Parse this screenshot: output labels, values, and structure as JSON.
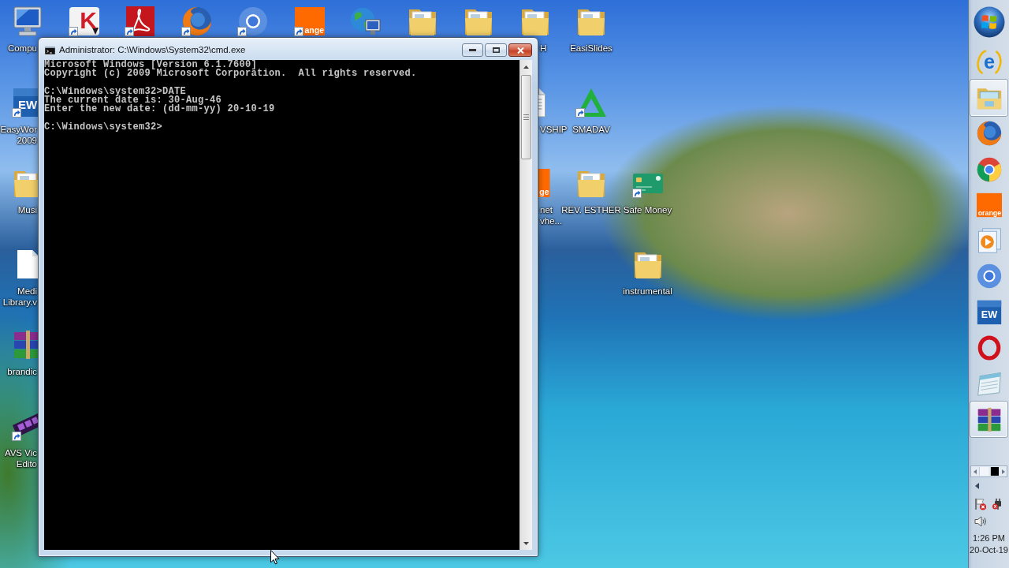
{
  "desktop": {
    "icons": [
      {
        "kind": "monitor",
        "label_lines": [
          "Compu"
        ],
        "shortcut": false
      },
      {
        "kind": "letter-logo",
        "logo_text": "K",
        "shortcut": true
      },
      {
        "kind": "swirl-tile",
        "shortcut": true
      },
      {
        "kind": "flame-globe",
        "shortcut": true
      },
      {
        "kind": "ring",
        "shortcut": true
      },
      {
        "kind": "orange-tile",
        "logo_text": "ange",
        "shortcut": true
      },
      {
        "kind": "globe-screen",
        "shortcut": false
      },
      {
        "kind": "folder",
        "shortcut": false
      },
      {
        "kind": "folder",
        "shortcut": false
      },
      {
        "kind": "folder",
        "label_lines": [
          "H"
        ],
        "shortcut": false
      },
      {
        "kind": "folder",
        "label_lines": [
          "EasiSlides"
        ],
        "shortcut": false
      },
      {
        "kind": "blue-tile",
        "logo_text": "EW",
        "label_lines": [
          "EasyWor",
          "2009"
        ],
        "shortcut": true
      },
      {
        "kind": "document",
        "label_lines": [
          "VSHIP"
        ],
        "shortcut": false
      },
      {
        "kind": "triangle",
        "label_lines": [
          "SMADAV"
        ],
        "shortcut": true
      },
      {
        "kind": "folder",
        "label_lines": [
          "Musi"
        ],
        "shortcut": false
      },
      {
        "kind": "orange-tile",
        "logo_text": "ge",
        "label_lines": [
          "net",
          "vhe..."
        ],
        "shortcut": false
      },
      {
        "kind": "folder",
        "label_lines": [
          "REV. ESTHER"
        ],
        "shortcut": false
      },
      {
        "kind": "card",
        "label_lines": [
          "Safe Money"
        ],
        "shortcut": true
      },
      {
        "kind": "blank-page",
        "label_lines": [
          "Medi",
          "Library.v"
        ],
        "shortcut": false
      },
      {
        "kind": "folder",
        "label_lines": [
          "instrumental"
        ],
        "shortcut": false
      },
      {
        "kind": "books",
        "label_lines": [
          "brandic"
        ],
        "shortcut": false
      },
      {
        "kind": "film",
        "label_lines": [
          "AVS Vic",
          "Edito"
        ],
        "shortcut": true
      }
    ]
  },
  "console_window": {
    "title": "Administrator: C:\\Windows\\System32\\cmd.exe",
    "caption_buttons": [
      {
        "kind": "minimize"
      },
      {
        "kind": "maximize"
      },
      {
        "kind": "close"
      }
    ],
    "output_blocks": [
      [
        "Microsoft Windows [Version 6.1.7600]",
        "Copyright (c) 2009 Microsoft Corporation.  All rights reserved."
      ],
      [
        "C:\\Windows\\system32>DATE",
        "The current date is: 30-Aug-46",
        "Enter the new date: (dd-mm-yy) 20-10-19"
      ],
      [
        "C:\\Windows\\system32>"
      ]
    ]
  },
  "taskbar": {
    "items": [
      {
        "kind": "e-logo",
        "logo_text": "e",
        "running": false
      },
      {
        "kind": "folder-window",
        "running": true
      },
      {
        "kind": "flame-globe",
        "running": false
      },
      {
        "kind": "segmented-circle",
        "running": false
      },
      {
        "kind": "orange-tile",
        "logo_text": "orange",
        "running": false
      },
      {
        "kind": "play-pages",
        "running": false
      },
      {
        "kind": "ring",
        "running": false
      },
      {
        "kind": "blue-tile",
        "logo_text": "EW",
        "running": false
      },
      {
        "kind": "o-ring",
        "running": false
      },
      {
        "kind": "notepad",
        "running": false
      },
      {
        "kind": "books",
        "running": true
      }
    ],
    "pager": {
      "slots": [
        {
          "selected": false
        },
        {
          "selected": true
        }
      ]
    },
    "clock": {
      "time": "1:26 PM",
      "date": "20-Oct-19"
    }
  }
}
